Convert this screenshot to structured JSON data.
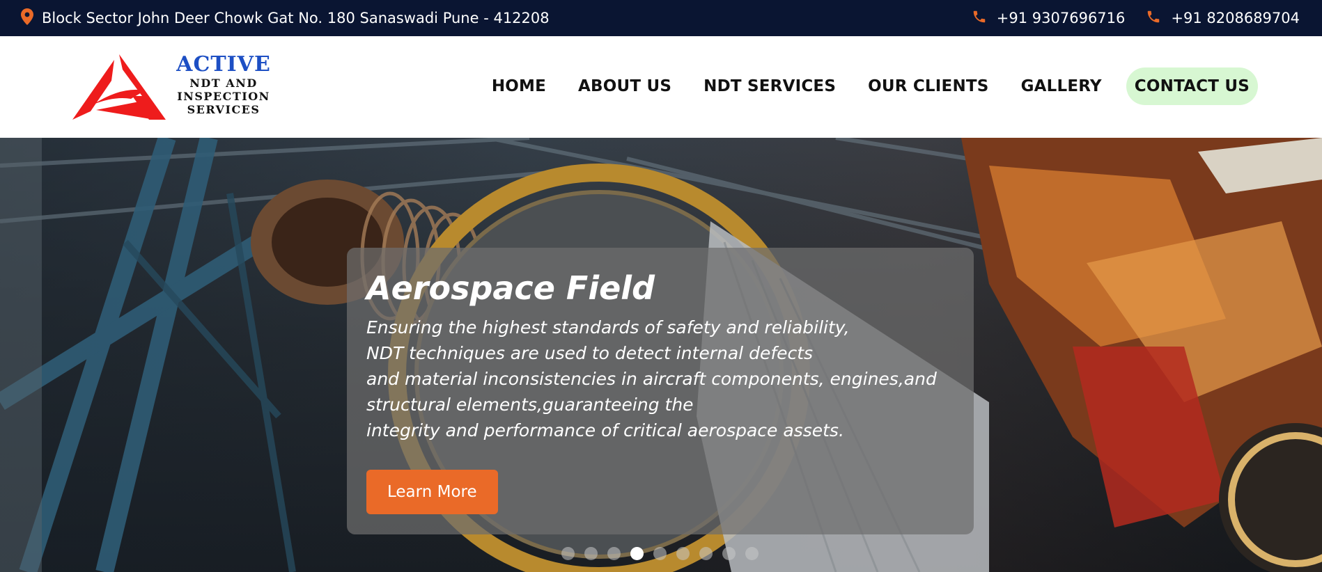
{
  "topbar": {
    "address": "Block Sector John Deer Chowk Gat No. 180 Sanaswadi Pune - 412208",
    "address_icon": "map-pin-icon",
    "phone_icon": "phone-icon",
    "phones": [
      "+91 9307696716",
      "+91 8208689704"
    ],
    "bg_color": "#0a1532",
    "icon_color": "#ea6a28"
  },
  "logo": {
    "brand": "ACTIVE",
    "line1": "NDT AND",
    "line2": "INSPECTION",
    "line3": "SERVICES",
    "brand_color": "#1d4fc4",
    "mark_color": "#ee1c1c"
  },
  "nav": {
    "items": [
      "HOME",
      "ABOUT US",
      "NDT SERVICES",
      "OUR CLIENTS",
      "GALLERY",
      "CONTACT US"
    ],
    "active_index": 5,
    "active_bg": "#d7f7d2"
  },
  "hero": {
    "title": "Aerospace Field",
    "lines": [
      "Ensuring the highest standards of safety and reliability,",
      "NDT techniques are used to detect internal defects",
      "and material inconsistencies in aircraft components, engines,and",
      "structural elements,guaranteeing the",
      "integrity and performance of critical aerospace assets."
    ],
    "button_label": "Learn More",
    "button_color": "#ea6a28",
    "slide_count": 9,
    "active_slide": 4
  }
}
